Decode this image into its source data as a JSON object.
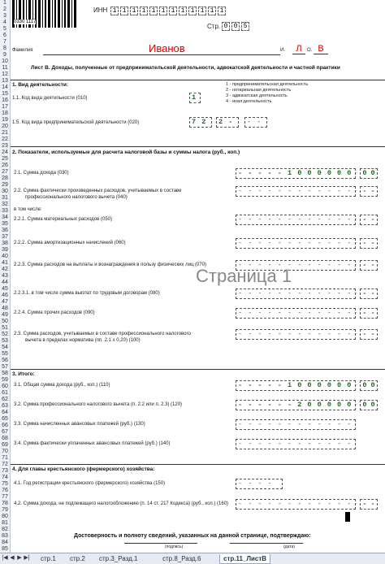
{
  "row_numbers": [
    "1",
    "2",
    "3",
    "4",
    "5",
    "6",
    "7",
    "8",
    "9",
    "10",
    "11",
    "12",
    "13",
    "14",
    "15",
    "16",
    "17",
    "18",
    "19",
    "20",
    "21",
    "22",
    "23",
    "24",
    "25",
    "26",
    "27",
    "28",
    "29",
    "30",
    "31",
    "32",
    "33",
    "34",
    "35",
    "36",
    "37",
    "38",
    "39",
    "40",
    "41",
    "42",
    "43",
    "44",
    "45",
    "46",
    "47",
    "48",
    "49",
    "50",
    "51",
    "52",
    "53",
    "54",
    "55",
    "56",
    "57",
    "58",
    "59",
    "60",
    "61",
    "62",
    "63",
    "64",
    "65",
    "66",
    "67",
    "68",
    "69",
    "70",
    "71",
    "72",
    "73",
    "74",
    "75",
    "76",
    "77",
    "78",
    "79",
    "80",
    "81",
    "82",
    "83",
    "84",
    "85"
  ],
  "header": {
    "barcode_number": "0330 1117",
    "inn_label": "ИНН",
    "inn_value": [
      "1",
      "1",
      "1",
      "1",
      "1",
      "1",
      "1",
      "1",
      "1",
      "1",
      "1",
      "1"
    ],
    "page_label": "Стр.",
    "page_value": [
      "0",
      "0",
      "5"
    ],
    "surname_label": "Фамилия",
    "surname": "Иванов",
    "initial_i_label": "И.",
    "initial_i": "Л",
    "initial_o_label": "О.",
    "initial_o": "В"
  },
  "title": "Лист В. Доходы, полученные от предпринимательской деятельности, адвокатской деятельности и частной практики",
  "section1": {
    "heading": "1. Вид деятельности:",
    "l11": "1.1. Код вида деятельности (010)",
    "l11_value": "1",
    "legend": [
      "1 - предпринимательская деятельность",
      "2 - нотариальная деятельность",
      "3 - адвокатская деятельность",
      "4 - иная деятельность"
    ],
    "l15": "1.5. Код вида предпринимательской деятельности (020)",
    "l15_value_a": "7 2",
    "l15_value_b": "2 -",
    "l15_value_c": "- -"
  },
  "section2": {
    "heading": "2. Показатели, используемые для расчета налоговой базы и суммы налога (руб., коп.)",
    "rows": [
      {
        "label": "2.1. Сумма дохода (030)",
        "value": "- - - - - 1 0 0 0 0 0 0",
        "dec": "0 0"
      },
      {
        "label": "2.2. Сумма фактически произведенных расходов, учитываемых в составе",
        "label2": "профессионального налогового вычета (040)",
        "value": "- - - - - - - - - - - -",
        "dec": "- -"
      },
      {
        "label": "в том числе:",
        "value": "",
        "dec": ""
      },
      {
        "label": "2.2.1. Сумма материальных расходов (050)",
        "value": "- - - - - - - - - - - -",
        "dec": "- -"
      },
      {
        "label": "2.2.2. Сумма амортизационных начислений (060)",
        "value": "- - - - - - - - - - - -",
        "dec": "- -"
      },
      {
        "label": "2.2.3. Сумма расходов на выплаты и вознаграждения в пользу физических лиц (070)",
        "value": "- - - - - - - - - - - -",
        "dec": "- -"
      },
      {
        "label": "2.2.3.1. в том числе сумма выплат по трудовым договорам (080)",
        "value": "- - - - - - - - - - - -",
        "dec": "- -"
      },
      {
        "label": "2.2.4. Сумма прочих расходов (090)",
        "value": "- - - - - - - - - - - -",
        "dec": "- -"
      },
      {
        "label": "2.3. Сумма расходов, учитываемых в составе профессионального налогового",
        "label2": "вычета в пределах норматива (пп. 2.1 х 0,20) (100)",
        "value": "- - - - - - - - - - - -",
        "dec": "- -"
      }
    ]
  },
  "watermark": "Страница 1",
  "section3": {
    "heading": "3. Итого:",
    "rows": [
      {
        "label": "3.1. Общая сумма дохода (руб., коп.) (110)",
        "value": "- - - - - 1 0 0 0 0 0 0",
        "dec": "0 0"
      },
      {
        "label": "3.2. Сумма профессионального налогового вычета (п. 2.2 или п. 2.3) (120)",
        "value": "- - - - - - 2 0 0 0 0 0",
        "dec": "0 0"
      },
      {
        "label": "3.3. Сумма начисленных авансовых платежей (руб.) (130)",
        "value": "- - - - - - - - - - - -",
        "dec": ""
      },
      {
        "label": "3.4. Сумма фактически уплаченных авансовых платежей (руб.) (140)",
        "value": "- - - - - - - - - - - -",
        "dec": ""
      }
    ]
  },
  "section4": {
    "heading": "4. Для главы крестьянского (фермерского) хозяйства:",
    "rows": [
      {
        "label": "4.1. Год регистрации крестьянского (фермерского) хозяйства (150)",
        "value": "- - - -",
        "dec": ""
      },
      {
        "label": "4.2. Сумма дохода, не подлежащего налогообложению (п. 14 ст. 217 Кодекса) (руб., коп.) (160)",
        "value": "- - - - - - - - - - - -",
        "dec": "- -"
      }
    ]
  },
  "footer": {
    "confirm": "Достоверность и полноту сведений, указанных на данной странице, подтверждаю:",
    "sign": "(подпись)",
    "date": "(дата)"
  },
  "tabs": [
    "стр.1",
    "стр.2",
    "стр.3_Разд.1",
    "стр.8_Разд.6",
    "стр.11_ЛистВ"
  ],
  "active_tab": "стр.11_ЛистВ",
  "colors": {
    "filled": "#1c6a1c",
    "name": "#d40000"
  }
}
